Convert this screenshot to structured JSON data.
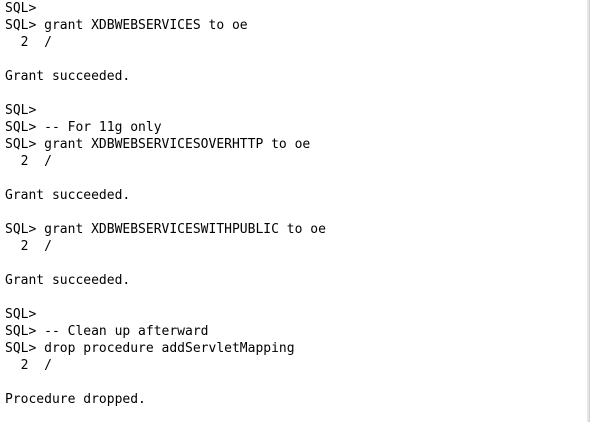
{
  "terminal": {
    "lines": [
      "SQL>",
      "SQL> grant XDBWEBSERVICES to oe",
      "  2  /",
      "",
      "Grant succeeded.",
      "",
      "SQL>",
      "SQL> -- For 11g only",
      "SQL> grant XDBWEBSERVICESOVERHTTP to oe",
      "  2  /",
      "",
      "Grant succeeded.",
      "",
      "SQL> grant XDBWEBSERVICESWITHPUBLIC to oe",
      "  2  /",
      "",
      "Grant succeeded.",
      "",
      "SQL>",
      "SQL> -- Clean up afterward",
      "SQL> drop procedure addServletMapping",
      "  2  /",
      "",
      "Procedure dropped."
    ]
  }
}
